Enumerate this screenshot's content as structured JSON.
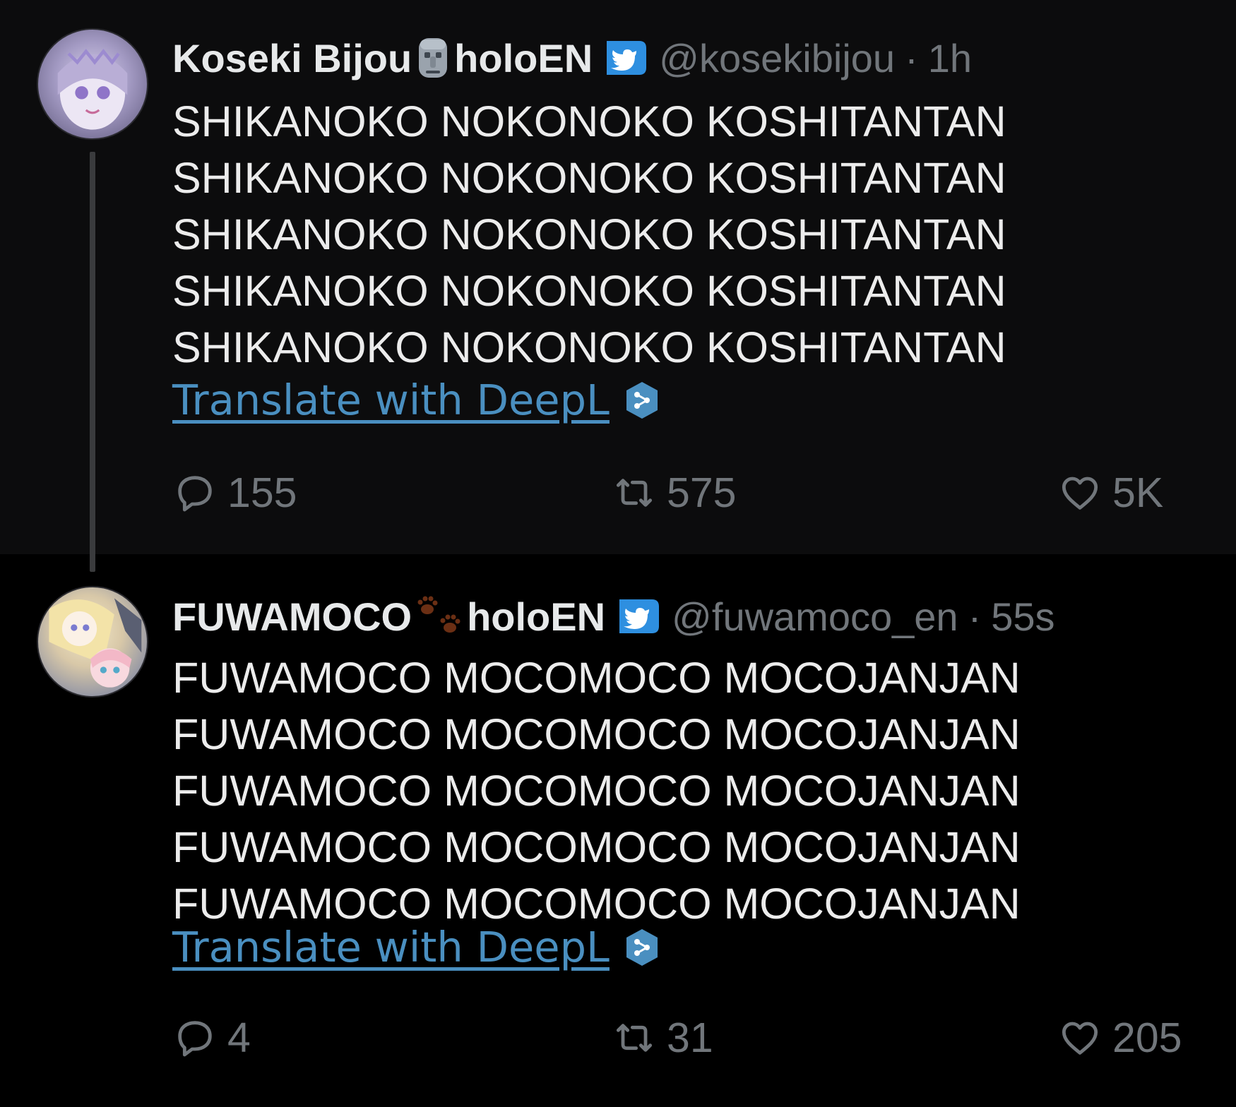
{
  "tweets": [
    {
      "display_name": "Koseki Bijou",
      "name_emoji": "moai-emoji",
      "org": "holoEN",
      "handle": "@kosekibijou",
      "separator": "·",
      "time": "1h",
      "lines": [
        "SHIKANOKO NOKONOKO KOSHITANTAN",
        "SHIKANOKO NOKONOKO KOSHITANTAN",
        "SHIKANOKO NOKONOKO KOSHITANTAN",
        "SHIKANOKO NOKONOKO KOSHITANTAN",
        "SHIKANOKO NOKONOKO KOSHITANTAN"
      ],
      "translate_label": "Translate with DeepL",
      "replies": "155",
      "retweets": "575",
      "likes": "5K"
    },
    {
      "display_name": "FUWAMOCO",
      "name_emoji": "paw-prints-emoji",
      "org": "holoEN",
      "handle": "@fuwamoco_en",
      "separator": "·",
      "time": "55s",
      "lines": [
        "FUWAMOCO MOCOMOCO MOCOJANJAN",
        "FUWAMOCO MOCOMOCO MOCOJANJAN",
        "FUWAMOCO MOCOMOCO MOCOJANJAN",
        "FUWAMOCO MOCOMOCO MOCOJANJAN",
        "FUWAMOCO MOCOMOCO MOCOJANJAN"
      ],
      "translate_label": "Translate with DeepL",
      "replies": "4",
      "retweets": "31",
      "likes": "205"
    }
  ],
  "colors": {
    "background_top": "#0c0c0d",
    "background_bottom": "#000000",
    "text": "#e7e9ea",
    "muted": "#71767b",
    "link": "#4a8fc0",
    "badge": "#2e8fe0"
  },
  "icons": {
    "verified": "twitter-bird-badge-icon",
    "translate": "deepl-icon",
    "reply": "reply-icon",
    "retweet": "retweet-icon",
    "like": "heart-icon"
  }
}
